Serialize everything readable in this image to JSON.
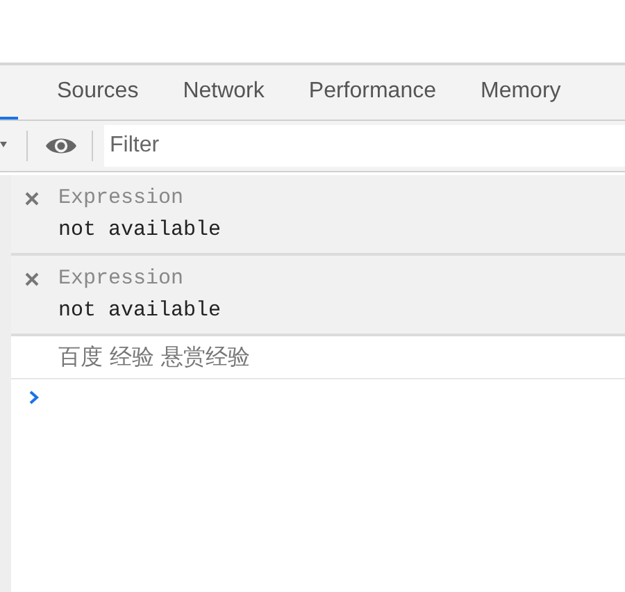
{
  "tabs": [
    {
      "selected": true
    },
    {
      "label": "Sources",
      "selected": false
    },
    {
      "label": "Network",
      "selected": false
    },
    {
      "label": "Performance",
      "selected": false
    },
    {
      "label": "Memory",
      "selected": false
    }
  ],
  "filter": {
    "placeholder": "Filter"
  },
  "live_expressions": [
    {
      "expression": "Expression",
      "value": "not available"
    },
    {
      "expression": "Expression",
      "value": "not available"
    }
  ],
  "messages": [
    "百度 经验 悬赏经验"
  ]
}
